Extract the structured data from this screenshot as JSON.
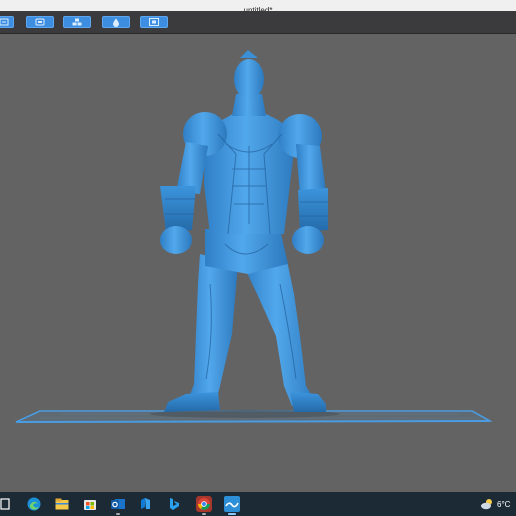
{
  "window": {
    "title": "untitled*"
  },
  "toolbar": {
    "buttons": [
      {
        "icon": "import-icon"
      },
      {
        "icon": "layout-icon"
      },
      {
        "icon": "support-icon"
      },
      {
        "icon": "paint-icon"
      },
      {
        "icon": "fit-view-icon"
      }
    ],
    "accent": "#3d8ee0"
  },
  "viewport": {
    "model_color": "#3f97dd",
    "background": "#636363",
    "build_plate_color": "#4a9be0"
  },
  "taskbar": {
    "apps": [
      {
        "icon": "task-view-icon"
      },
      {
        "icon": "edge-icon"
      },
      {
        "icon": "file-explorer-icon"
      },
      {
        "icon": "store-icon"
      },
      {
        "icon": "outlook-icon"
      },
      {
        "icon": "app-n-icon"
      },
      {
        "icon": "bing-icon"
      },
      {
        "icon": "chrome-icon"
      },
      {
        "icon": "slicer-app-icon"
      }
    ],
    "weather": {
      "icon": "cloud-sun-icon",
      "temperature": "6°C"
    }
  }
}
